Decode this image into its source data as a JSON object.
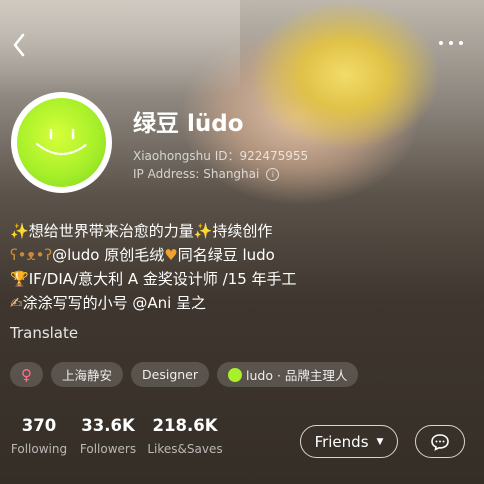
{
  "profile": {
    "name": "绿豆 lüdo",
    "id_text": "Xiaohongshu ID：922475955",
    "ip_text": "IP Address: Shanghai"
  },
  "bio": {
    "line1": "想给世界带来治愈的力量",
    "line1_end": "持续创作",
    "line2_a": "@ludo 原创毛绒",
    "line2_b": "同名绿豆 ludo",
    "line3": "IF/DIA/意大利 A 金奖设计师 /15 年手工",
    "line4": "涂涂写写的小号 @Ani 呈之"
  },
  "translate_label": "Translate",
  "tags": {
    "gender": "♀",
    "location": "上海静安",
    "job": "Designer",
    "brand": "ludo · 品牌主理人"
  },
  "stats": {
    "following": {
      "value": "370",
      "label": "Following"
    },
    "followers": {
      "value": "33.6K",
      "label": "Followers"
    },
    "likes": {
      "value": "218.6K",
      "label": "Likes&Saves"
    }
  },
  "actions": {
    "friends_label": "Friends"
  },
  "icons": {
    "back": "back-arrow-icon",
    "more": "more-dots-icon",
    "info": "info-icon",
    "message": "message-icon",
    "caret": "chevron-down-icon"
  },
  "colors": {
    "avatar_green": "#a8f02a",
    "gender_pink": "#ff6f8a"
  }
}
